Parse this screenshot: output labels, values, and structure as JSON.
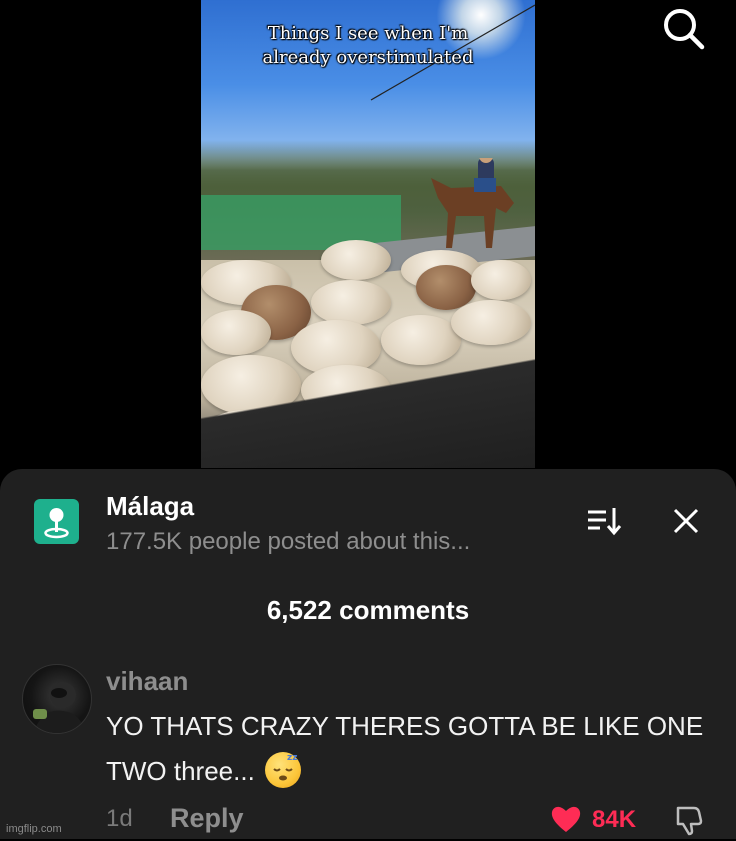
{
  "video": {
    "caption_line1": "Things I see when I'm",
    "caption_line2": "already overstimulated"
  },
  "top_bar": {
    "search_icon": "search-icon"
  },
  "location": {
    "icon": "location-pin-icon",
    "title": "Málaga",
    "subtitle": "177.5K people posted about this..."
  },
  "header_actions": {
    "sort_icon": "sort-icon",
    "close_icon": "close-icon"
  },
  "comments": {
    "count_label": "6,522 comments",
    "items": [
      {
        "username": "vihaan",
        "text": "YO THATS CRAZY THERES GOTTA BE LIKE ONE TWO three...",
        "emoji": "sleeping-face",
        "time": "1d",
        "reply_label": "Reply",
        "likes": "84K",
        "liked": true
      }
    ]
  },
  "watermark": "imgflip.com",
  "colors": {
    "sheet_bg": "#202020",
    "like_red": "#fe2c55",
    "location_green": "#1eb08d"
  }
}
